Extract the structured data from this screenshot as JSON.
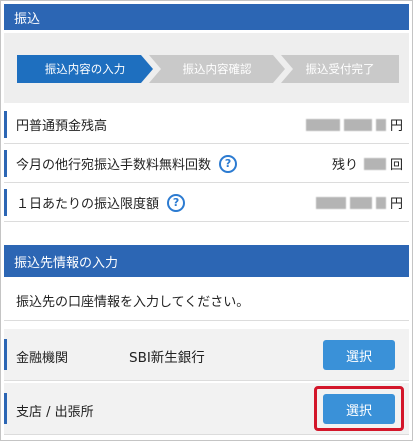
{
  "header1": {
    "title": "振込"
  },
  "steps": [
    {
      "label": "振込内容の入力"
    },
    {
      "label": "振込内容確認"
    },
    {
      "label": "振込受付完了"
    }
  ],
  "rows": {
    "balance": {
      "label": "円普通預金残高",
      "unit": "円"
    },
    "free_count": {
      "label": "今月の他行宛振込手数料無料回数",
      "prefix": "残り",
      "unit": "回"
    },
    "limit": {
      "label": "１日あたりの振込限度額",
      "unit": "円"
    }
  },
  "header2": {
    "title": "振込先情報の入力"
  },
  "intro": "振込先の口座情報を入力してください。",
  "fields": {
    "bank": {
      "label": "金融機関",
      "value": "SBI新生銀行",
      "button": "選択"
    },
    "branch": {
      "label": "支店 / 出張所",
      "button": "選択"
    }
  },
  "colors": {
    "primary": "#2c66b4",
    "button": "#3a91d8",
    "highlight": "#d3162a"
  },
  "icons": {
    "help": "question-circle-icon"
  }
}
